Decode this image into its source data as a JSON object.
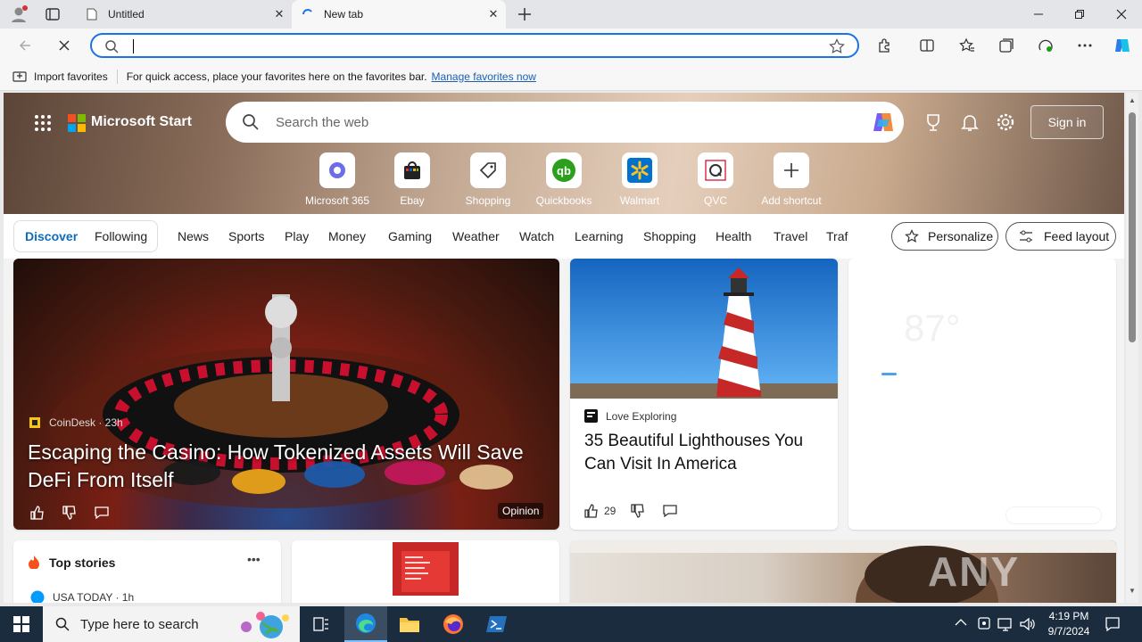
{
  "browser": {
    "tabs": [
      {
        "title": "Untitled"
      },
      {
        "title": "New tab"
      }
    ],
    "address_value": "",
    "favorites_bar": {
      "import_label": "Import favorites",
      "message": "For quick access, place your favorites here on the favorites bar.",
      "manage_link": "Manage favorites now"
    }
  },
  "start": {
    "logo_text": "Microsoft Start",
    "search_placeholder": "Search the web",
    "sign_in": "Sign in",
    "shortcuts": [
      {
        "label": "Microsoft 365",
        "icon": "m365-icon"
      },
      {
        "label": "Ebay",
        "icon": "ebay-icon"
      },
      {
        "label": "Shopping",
        "icon": "shopping-tag-icon"
      },
      {
        "label": "Quickbooks",
        "icon": "quickbooks-icon"
      },
      {
        "label": "Walmart",
        "icon": "walmart-icon"
      },
      {
        "label": "QVC",
        "icon": "qvc-icon"
      },
      {
        "label": "Add shortcut",
        "icon": "plus-icon"
      }
    ],
    "feed_tabs": [
      "Discover",
      "Following"
    ],
    "categories": [
      "News",
      "Sports",
      "Play",
      "Money",
      "Gaming",
      "Weather",
      "Watch",
      "Learning",
      "Shopping",
      "Health",
      "Travel",
      "Traf"
    ],
    "personalize": "Personalize",
    "feed_layout": "Feed layout"
  },
  "cards": {
    "hero": {
      "source": "CoinDesk · 23h",
      "headline": "Escaping the Casino: How Tokenized Assets Will Save DeFi From Itself",
      "badge": "Opinion"
    },
    "lighthouse": {
      "source": "Love Exploring",
      "headline": "35 Beautiful Lighthouses You Can Visit In America",
      "likes": "29"
    },
    "weather": {
      "temp": "87°"
    },
    "top_stories": {
      "title": "Top stories",
      "source": "USA TODAY · 1h"
    }
  },
  "taskbar": {
    "search_placeholder": "Type here to search",
    "time": "4:19 PM",
    "date": "9/7/2024"
  },
  "watermark": "ANY RUN"
}
